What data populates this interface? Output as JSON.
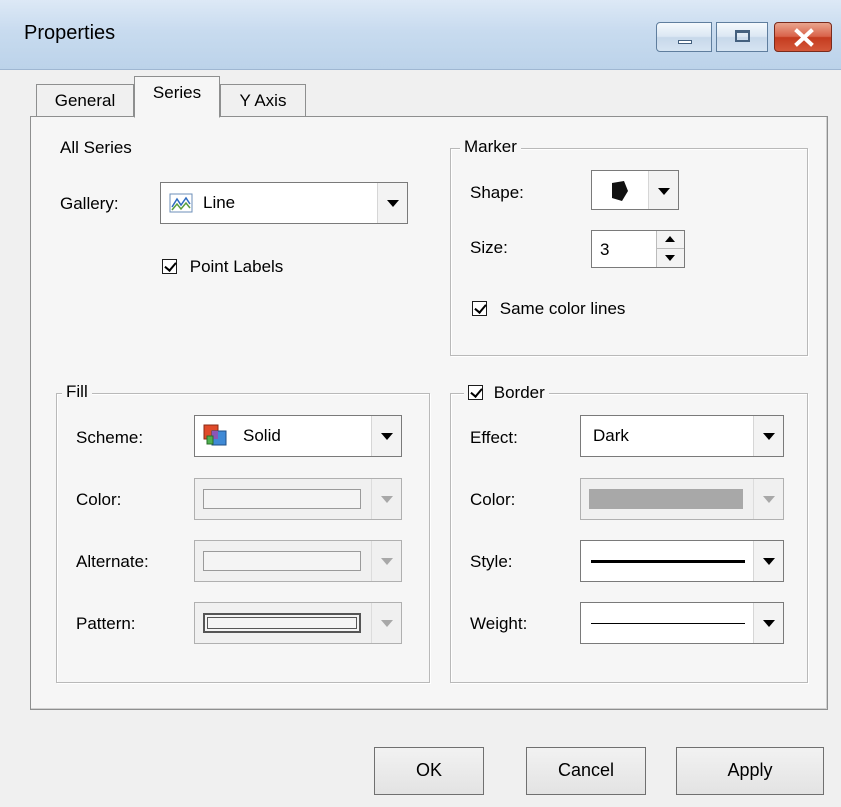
{
  "window": {
    "title": "Properties"
  },
  "tabs": [
    {
      "label": "General",
      "active": false
    },
    {
      "label": "Series",
      "active": true
    },
    {
      "label": "Y Axis",
      "active": false
    }
  ],
  "all_series": {
    "heading": "All Series",
    "gallery_label": "Gallery:",
    "gallery_value": "Line",
    "gallery_icon": "line-chart-icon",
    "point_labels": {
      "label": "Point Labels",
      "checked": true
    }
  },
  "marker": {
    "legend": "Marker",
    "shape_label": "Shape:",
    "shape_icon": "marker-shape-icon",
    "size_label": "Size:",
    "size_value": "3",
    "same_color": {
      "label": "Same color lines",
      "checked": true
    }
  },
  "fill": {
    "legend": "Fill",
    "scheme_label": "Scheme:",
    "scheme_value": "Solid",
    "scheme_icon": "solid-fill-icon",
    "color_label": "Color:",
    "alternate_label": "Alternate:",
    "pattern_label": "Pattern:"
  },
  "border": {
    "legend": "Border",
    "checked": true,
    "effect_label": "Effect:",
    "effect_value": "Dark",
    "color_label": "Color:",
    "color_swatch": "#a8a8a8",
    "style_label": "Style:",
    "weight_label": "Weight:"
  },
  "buttons": {
    "ok": "OK",
    "cancel": "Cancel",
    "apply": "Apply"
  }
}
